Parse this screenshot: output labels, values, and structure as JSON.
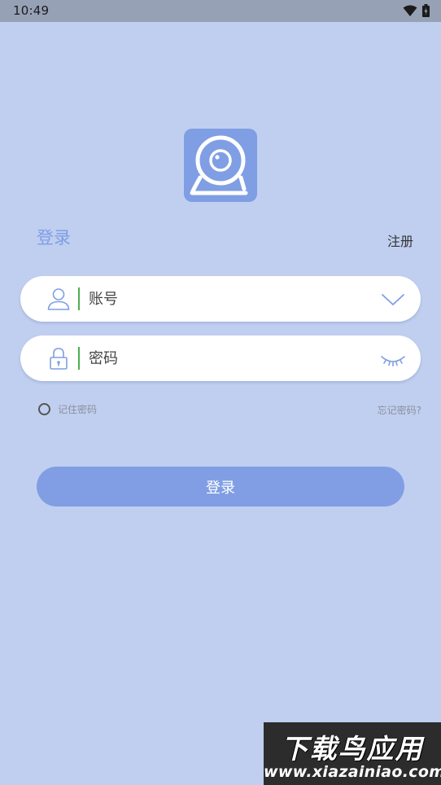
{
  "status_bar": {
    "time": "10:49",
    "icons": [
      "wifi-icon",
      "battery-icon"
    ]
  },
  "app": {
    "logo_icon": "webcam-icon",
    "accent_color": "#7f9ee4"
  },
  "tabs": {
    "login": "登录",
    "register": "注册"
  },
  "form": {
    "account": {
      "placeholder": "账号",
      "value": "",
      "icon": "user-icon",
      "right_icon": "chevron-down-icon"
    },
    "password": {
      "placeholder": "密码",
      "value": "",
      "icon": "lock-icon",
      "right_icon": "eye-closed-icon"
    },
    "remember_label": "记住密码",
    "forgot_label": "忘记密码?",
    "submit_label": "登录"
  },
  "watermark": {
    "title": "下载鸟应用",
    "url": "www.xiazainiao.com"
  }
}
